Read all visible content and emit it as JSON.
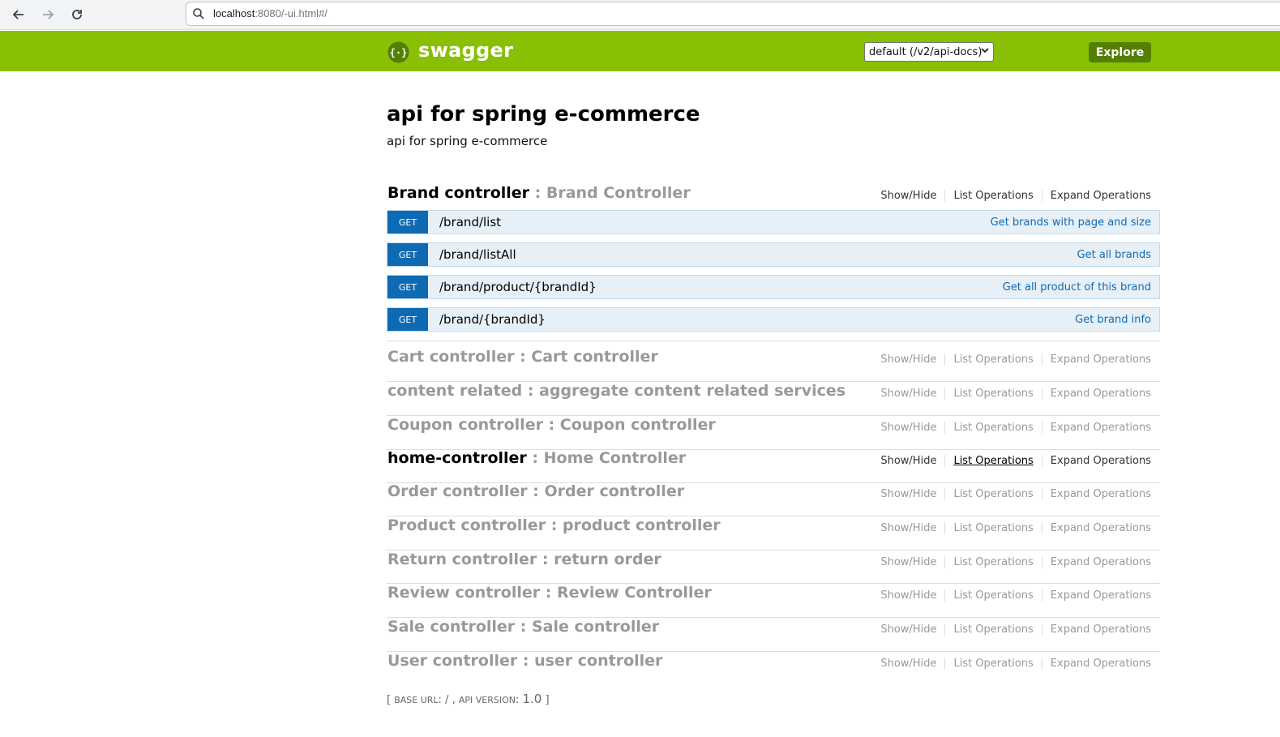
{
  "browser": {
    "url_host": "localhost",
    "url_rest": ":8080/-ui.html#/"
  },
  "header": {
    "brand": "swagger",
    "select_value": "default (/v2/api-docs)",
    "explore_label": "Explore"
  },
  "api": {
    "title": "api for spring e-commerce",
    "description": "api for spring e-commerce"
  },
  "actions": {
    "show_hide": "Show/Hide",
    "list_ops": "List Operations",
    "expand_ops": "Expand Operations"
  },
  "resources": [
    {
      "name": "Brand controller",
      "sep": " : ",
      "desc": "Brand Controller"
    },
    {
      "name": "Cart controller",
      "sep": " : ",
      "desc": "Cart controller"
    },
    {
      "name": "content related",
      "sep": " : ",
      "desc": "aggregate content related services"
    },
    {
      "name": "Coupon controller",
      "sep": " : ",
      "desc": "Coupon controller"
    },
    {
      "name": "home-controller",
      "sep": " : ",
      "desc": "Home Controller"
    },
    {
      "name": "Order controller",
      "sep": " : ",
      "desc": "Order controller"
    },
    {
      "name": "Product controller",
      "sep": " : ",
      "desc": "product controller"
    },
    {
      "name": "Return controller",
      "sep": " : ",
      "desc": "return order"
    },
    {
      "name": "Review controller",
      "sep": " : ",
      "desc": "Review Controller"
    },
    {
      "name": "Sale controller",
      "sep": " : ",
      "desc": "Sale controller"
    },
    {
      "name": "User controller",
      "sep": " : ",
      "desc": "user controller"
    }
  ],
  "operations": [
    {
      "method": "GET",
      "path": "/brand/list",
      "summary": "Get brands with page and size"
    },
    {
      "method": "GET",
      "path": "/brand/listAll",
      "summary": "Get all brands"
    },
    {
      "method": "GET",
      "path": "/brand/product/{brandId}",
      "summary": "Get all product of this brand"
    },
    {
      "method": "GET",
      "path": "/brand/{brandId}",
      "summary": "Get brand info"
    }
  ],
  "footer": {
    "open": "[ ",
    "base_label": "Base URL",
    "base_value": ": / , ",
    "version_label": "Api Version",
    "version_colon": ": ",
    "version_value": "1.0",
    "close": " ]"
  },
  "colors": {
    "header_green": "#89bf04",
    "explore_green": "#547f00",
    "get_blue": "#0f6ab4",
    "op_bg": "#e7f0f7"
  }
}
